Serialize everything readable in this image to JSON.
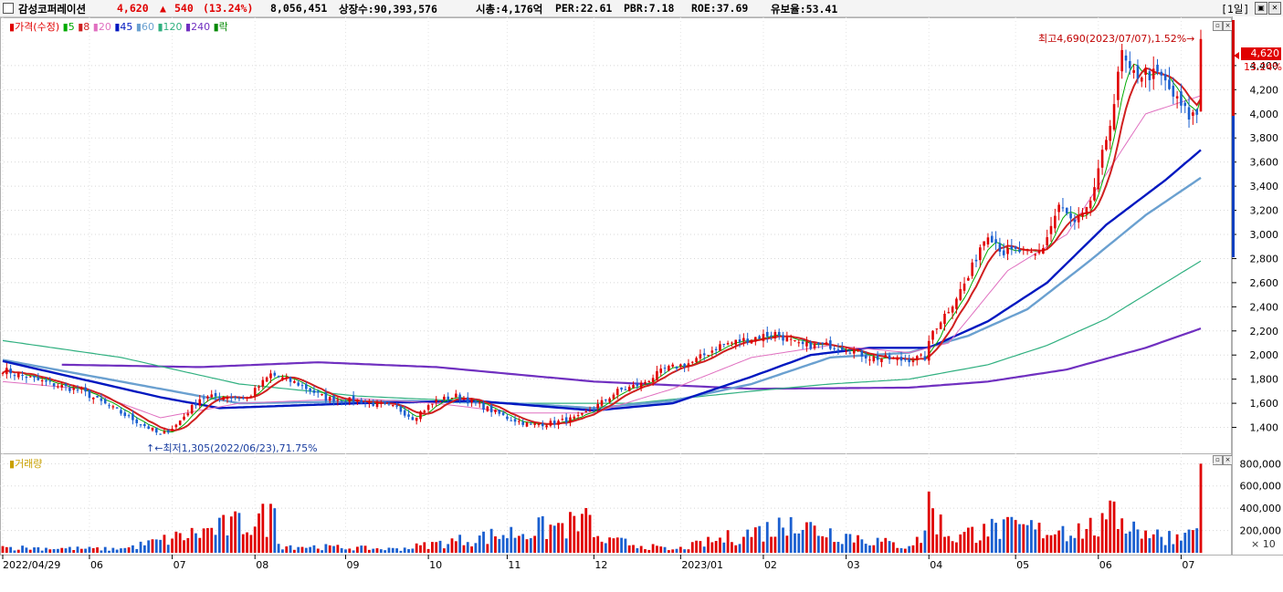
{
  "header": {
    "stock_name": "감성코퍼레이션",
    "price": "4,620",
    "change_arrow": "▲",
    "change": "540",
    "change_pct": "(13.24%)",
    "volume": "8,056,451",
    "listed": "상장수:90,393,576",
    "mktcap": "시총:4,176억",
    "per": "PER:22.61",
    "pbr": "PBR:7.18",
    "roe": "ROE:37.69",
    "float": "유보율:53.41",
    "period": "[1일]",
    "colors": {
      "up": "#e00000",
      "text": "#000000"
    }
  },
  "legend": {
    "price_label": "가격(수정)",
    "ma_labels": [
      "5",
      "8",
      "20",
      "45",
      "60",
      "120",
      "240"
    ],
    "ma_colors": [
      "#00aa00",
      "#d02020",
      "#e070c0",
      "#0018c0",
      "#6aa0d0",
      "#30b080",
      "#7030c0"
    ],
    "rock_label": "락"
  },
  "annotations": {
    "high": "최고4,690(2023/07/07),1.52%",
    "low": "최저1,305(2022/06/23),71.75%"
  },
  "volume_pane": {
    "label": "거래량",
    "multiplier": "× 10"
  },
  "side": {
    "current": "4,620",
    "current_pct": "13.24%"
  },
  "chart_data": {
    "type": "candlestick",
    "price_axis": {
      "min": 1200,
      "max": 4800,
      "ticks": [
        1400,
        1600,
        1800,
        2000,
        2200,
        2400,
        2600,
        2800,
        3000,
        3200,
        3400,
        3600,
        3800,
        4000,
        4200,
        4400
      ],
      "tick_labels": [
        "1,400",
        "1,600",
        "1,800",
        "2,000",
        "2,200",
        "2,400",
        "2,600",
        "2,800",
        "3,000",
        "3,200",
        "3,400",
        "3,600",
        "3,800",
        "4,000",
        "4,200",
        "4,400"
      ]
    },
    "volume_axis": {
      "min": 0,
      "max": 860000,
      "ticks": [
        200000,
        400000,
        600000,
        800000
      ],
      "tick_labels": [
        "200,000",
        "400,000",
        "600,000",
        "800,000"
      ]
    },
    "x_labels": [
      "2022/04/29",
      "06",
      "07",
      "08",
      "09",
      "10",
      "11",
      "12",
      "2023/01",
      "02",
      "03",
      "04",
      "05",
      "06",
      "07"
    ],
    "x_label_sessions": [
      0,
      22,
      43,
      64,
      87,
      108,
      128,
      150,
      172,
      193,
      214,
      235,
      257,
      278,
      299
    ],
    "sessions": 305,
    "price_keys": [
      [
        0,
        1880
      ],
      [
        10,
        1780
      ],
      [
        20,
        1700
      ],
      [
        30,
        1520
      ],
      [
        38,
        1380
      ],
      [
        40,
        1330
      ],
      [
        44,
        1420
      ],
      [
        50,
        1640
      ],
      [
        55,
        1660
      ],
      [
        62,
        1640
      ],
      [
        68,
        1840
      ],
      [
        75,
        1760
      ],
      [
        82,
        1640
      ],
      [
        90,
        1620
      ],
      [
        100,
        1560
      ],
      [
        104,
        1480
      ],
      [
        110,
        1620
      ],
      [
        115,
        1660
      ],
      [
        120,
        1600
      ],
      [
        128,
        1480
      ],
      [
        134,
        1420
      ],
      [
        140,
        1440
      ],
      [
        146,
        1480
      ],
      [
        150,
        1560
      ],
      [
        156,
        1700
      ],
      [
        162,
        1760
      ],
      [
        168,
        1880
      ],
      [
        175,
        1940
      ],
      [
        182,
        2080
      ],
      [
        190,
        2140
      ],
      [
        196,
        2180
      ],
      [
        202,
        2080
      ],
      [
        210,
        2080
      ],
      [
        214,
        2060
      ],
      [
        220,
        1980
      ],
      [
        228,
        1960
      ],
      [
        234,
        1980
      ],
      [
        236,
        2200
      ],
      [
        240,
        2380
      ],
      [
        245,
        2640
      ],
      [
        248,
        2900
      ],
      [
        250,
        3020
      ],
      [
        254,
        2850
      ],
      [
        258,
        2860
      ],
      [
        262,
        2820
      ],
      [
        264,
        2900
      ],
      [
        268,
        3240
      ],
      [
        272,
        3080
      ],
      [
        275,
        3180
      ],
      [
        278,
        3500
      ],
      [
        280,
        3800
      ],
      [
        282,
        4100
      ],
      [
        284,
        4500
      ],
      [
        286,
        4320
      ],
      [
        290,
        4340
      ],
      [
        294,
        4300
      ],
      [
        298,
        4100
      ],
      [
        301,
        3980
      ],
      [
        303,
        4000
      ],
      [
        304,
        4620
      ]
    ],
    "volume_keys": [
      [
        0,
        60000
      ],
      [
        30,
        40000
      ],
      [
        69,
        400000
      ],
      [
        70,
        80000
      ],
      [
        100,
        40000
      ],
      [
        149,
        340000
      ],
      [
        150,
        140000
      ],
      [
        155,
        130000
      ],
      [
        170,
        30000
      ],
      [
        200,
        320000
      ],
      [
        230,
        60000
      ],
      [
        234,
        200000
      ],
      [
        235,
        550000
      ],
      [
        240,
        150000
      ],
      [
        249,
        260000
      ],
      [
        263,
        270000
      ],
      [
        269,
        240000
      ],
      [
        280,
        300000
      ],
      [
        282,
        460000
      ],
      [
        290,
        200000
      ],
      [
        300,
        180000
      ],
      [
        303,
        220000
      ],
      [
        304,
        800000
      ]
    ],
    "ma_keys": {
      "ma20": [
        [
          0,
          1780
        ],
        [
          20,
          1720
        ],
        [
          40,
          1480
        ],
        [
          60,
          1600
        ],
        [
          90,
          1640
        ],
        [
          110,
          1600
        ],
        [
          130,
          1520
        ],
        [
          150,
          1520
        ],
        [
          170,
          1720
        ],
        [
          190,
          1980
        ],
        [
          210,
          2080
        ],
        [
          230,
          2020
        ],
        [
          240,
          2100
        ],
        [
          255,
          2700
        ],
        [
          270,
          3000
        ],
        [
          280,
          3500
        ],
        [
          290,
          4000
        ],
        [
          304,
          4150
        ]
      ],
      "ma45": [
        [
          0,
          1950
        ],
        [
          20,
          1800
        ],
        [
          40,
          1650
        ],
        [
          55,
          1560
        ],
        [
          90,
          1600
        ],
        [
          120,
          1620
        ],
        [
          150,
          1540
        ],
        [
          170,
          1600
        ],
        [
          190,
          1820
        ],
        [
          205,
          2000
        ],
        [
          220,
          2060
        ],
        [
          235,
          2060
        ],
        [
          250,
          2280
        ],
        [
          265,
          2600
        ],
        [
          280,
          3080
        ],
        [
          295,
          3450
        ],
        [
          304,
          3700
        ]
      ],
      "ma60": [
        [
          0,
          1960
        ],
        [
          20,
          1840
        ],
        [
          40,
          1720
        ],
        [
          60,
          1600
        ],
        [
          100,
          1620
        ],
        [
          130,
          1600
        ],
        [
          150,
          1560
        ],
        [
          170,
          1620
        ],
        [
          190,
          1760
        ],
        [
          210,
          1980
        ],
        [
          230,
          2020
        ],
        [
          245,
          2160
        ],
        [
          260,
          2380
        ],
        [
          275,
          2760
        ],
        [
          290,
          3160
        ],
        [
          304,
          3470
        ]
      ],
      "ma120": [
        [
          0,
          2120
        ],
        [
          30,
          1980
        ],
        [
          60,
          1760
        ],
        [
          90,
          1660
        ],
        [
          130,
          1600
        ],
        [
          160,
          1600
        ],
        [
          190,
          1700
        ],
        [
          210,
          1760
        ],
        [
          230,
          1800
        ],
        [
          250,
          1920
        ],
        [
          265,
          2080
        ],
        [
          280,
          2300
        ],
        [
          295,
          2600
        ],
        [
          304,
          2780
        ]
      ],
      "ma240": [
        [
          15,
          1920
        ],
        [
          50,
          1900
        ],
        [
          80,
          1940
        ],
        [
          110,
          1900
        ],
        [
          150,
          1780
        ],
        [
          190,
          1720
        ],
        [
          230,
          1730
        ],
        [
          250,
          1780
        ],
        [
          270,
          1880
        ],
        [
          290,
          2060
        ],
        [
          304,
          2220
        ]
      ]
    }
  }
}
